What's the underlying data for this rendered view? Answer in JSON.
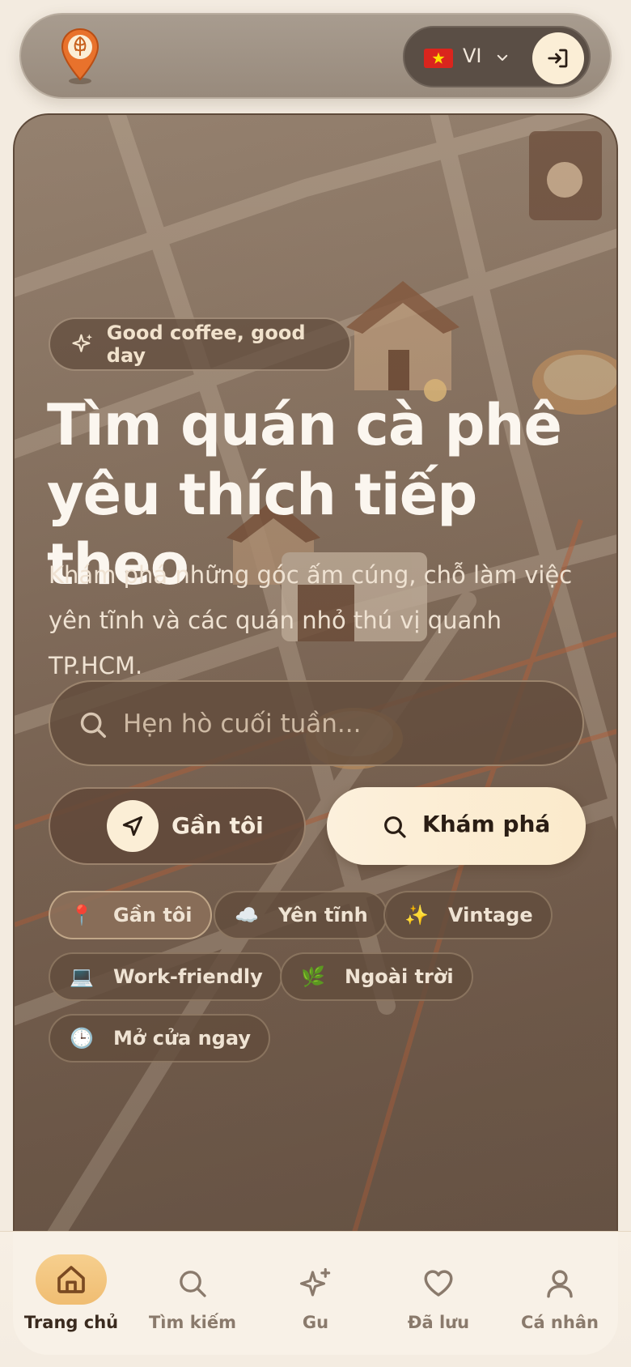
{
  "header": {
    "logo_icon": "coffee-pin-logo",
    "language": {
      "code": "VI",
      "flag_icon": "vietnam-flag-icon"
    },
    "login_icon": "login-icon"
  },
  "hero": {
    "tagline": "Good coffee, good day",
    "headline": "Tìm quán cà phê yêu thích tiếp theo",
    "subtitle": "Khám phá những góc ấm cúng, chỗ làm việc yên tĩnh và các quán nhỏ thú vị quanh TP.HCM.",
    "search_placeholder": "Hẹn hò cuối tuần...",
    "near_me_label": "Gần tôi",
    "explore_label": "Khám phá",
    "chips": [
      {
        "emoji": "📍",
        "label": "Gần tôi"
      },
      {
        "emoji": "☁️",
        "label": "Yên tĩnh"
      },
      {
        "emoji": "✨",
        "label": "Vintage"
      },
      {
        "emoji": "💻",
        "label": "Work-friendly"
      },
      {
        "emoji": "🌿",
        "label": "Ngoài trời"
      },
      {
        "emoji": "🕒",
        "label": "Mở cửa ngay"
      }
    ]
  },
  "nav": {
    "items": [
      {
        "label": "Trang chủ",
        "icon": "home-icon",
        "active": true
      },
      {
        "label": "Tìm kiếm",
        "icon": "search-icon",
        "active": false
      },
      {
        "label": "Gu",
        "icon": "sparkle-icon",
        "active": false
      },
      {
        "label": "Đã lưu",
        "icon": "heart-icon",
        "active": false
      },
      {
        "label": "Cá nhân",
        "icon": "user-icon",
        "active": false
      }
    ]
  },
  "colors": {
    "accent": "#f0bd72",
    "cream": "#fbeed6",
    "dark_brown": "#2a1d14"
  }
}
